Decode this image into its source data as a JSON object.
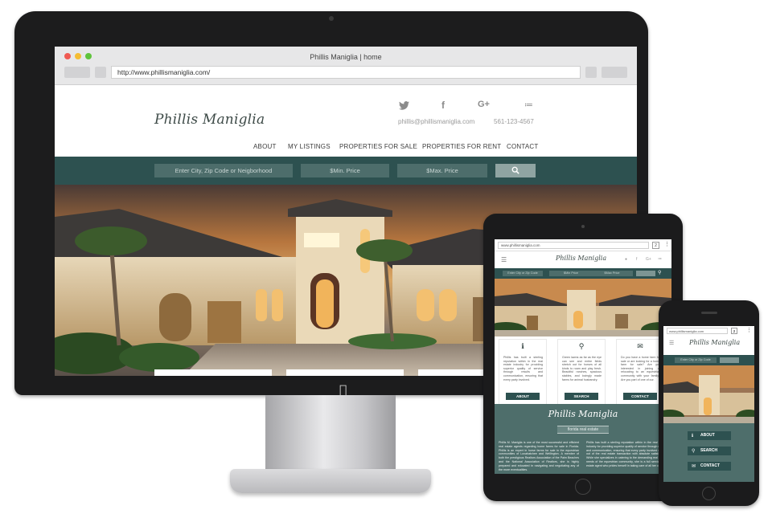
{
  "desktop": {
    "window_title": "Phillis Maniglia | home",
    "url": "http://www.phillismaniglia.com/",
    "site": {
      "logo": "Phillis Maniglia",
      "email": "phillis@phillismaniglia.com",
      "phone": "561-123-4567",
      "social_icons": [
        "twitter-icon",
        "facebook-icon",
        "google-plus-icon",
        "zillow-icon"
      ],
      "nav": [
        "ABOUT",
        "MY LISTINGS",
        "PROPERTIES FOR SALE",
        "PROPERTIES FOR RENT",
        "CONTACT"
      ],
      "search": {
        "location_placeholder": "Enter City, Zip Code or Neigborhood",
        "min_price_placeholder": "$Min. Price",
        "max_price_placeholder": "$Max. Price",
        "button_icon": "search-icon"
      }
    }
  },
  "tablet": {
    "url": "www.phillismaniglia.com",
    "tab_count": "2",
    "logo": "Phillis Maniglia",
    "search": {
      "location_placeholder": "Enter City or Zip Code",
      "min_price_placeholder": "$Min Price",
      "max_price_placeholder": "$Max Price"
    },
    "cards": [
      {
        "icon": "info-icon",
        "text": "Phillis has built a sterling reputation within in the real estate industry for providing superior quality of service through results and communication, ensuring that every party involved.",
        "button": "ABOUT"
      },
      {
        "icon": "search-icon",
        "text": "Green lawns as far as the eye can see and entire fields stretch out for horses of all kinds to roam and play fresh. Beautiful ranches, spacious stables, and lovingly made farms for animal husbandry.",
        "button": "SEARCH"
      },
      {
        "icon": "envelope-icon",
        "text": "Do you have a home farm for sale or are looking for a home farm for sale? Are you interested in joining or relocating to an equestrian community with your family? Are you part of one of our.",
        "button": "CONTACT"
      }
    ],
    "green_logo": "Phillis Maniglia",
    "subtitle": "florida real estate",
    "paragraph_left": "Phillis M. Maniglia is one of the most successful and efficient real estate agents regarding home farms for sale in Florida. Phillis is an expert in horse farms for sale in the equestrian communities of Loxahatchee and Wellington. A member of both the prestigious Realtors Association of the Palm Beaches and the National Association of Realtors, she is highly prepared and educated in navigating and negotiating any of the more eventualities.",
    "paragraph_right": "Phillis has built a sterling reputation within in the real estate industry for providing superior quality of service through results and communication, ensuring that every party involved comes out of the real estate transaction with absolute satisfaction. While she specializes in catering to the demanding real estate needs of the equestrian community, she is a full service real estate agent who prides herself in taking care of all her clients."
  },
  "phone": {
    "url": "www.phillismaniglia.com",
    "tab_count": "2",
    "logo": "Phillis Maniglia",
    "search_placeholder": "Enter City or Zip Code",
    "buttons": [
      {
        "icon": "info-icon",
        "label": "ABOUT"
      },
      {
        "icon": "search-icon",
        "label": "SEARCH"
      },
      {
        "icon": "envelope-icon",
        "label": "CONTACT"
      }
    ]
  },
  "colors": {
    "brand_dark_green": "#2d5150",
    "brand_mid_green": "#4e6e6b",
    "close": "#f05a52",
    "minimize": "#f5bd33",
    "maximize": "#5fc43c"
  }
}
